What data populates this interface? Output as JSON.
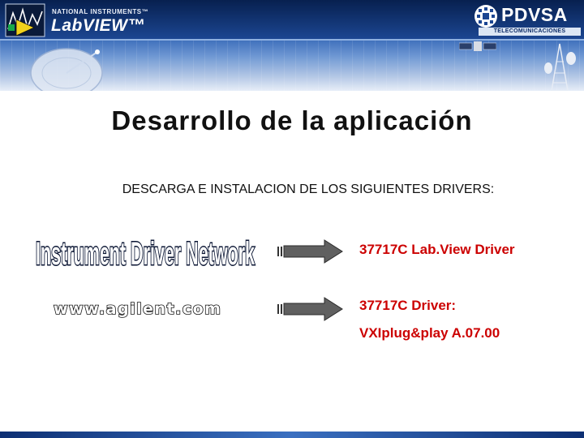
{
  "header": {
    "ni_brand": "NATIONAL INSTRUMENTS™",
    "product_name": "LabVIEW™",
    "company_name": "PDVSA",
    "company_division": "TELECOMUNICACIONES"
  },
  "slide": {
    "title": "Desarrollo de la aplicación",
    "subtitle": "DESCARGA E INSTALACION DE LOS SIGUIENTES DRIVERS:",
    "sources": {
      "network_logo_text": "Instrument Driver Network",
      "agilent_site": "www.agilent.com"
    },
    "drivers": {
      "labview_driver": "37717C Lab.View Driver",
      "driver_label": "37717C Driver:",
      "vxi_driver": "VXIplug&play A.07.00"
    }
  },
  "colors": {
    "banner_dark": "#0d2f73",
    "driver_text": "#cc0000",
    "arrow": "#606060"
  }
}
